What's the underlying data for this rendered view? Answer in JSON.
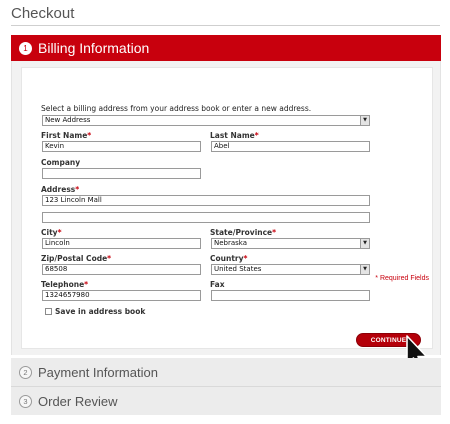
{
  "page": {
    "title": "Checkout"
  },
  "billing": {
    "step_number": "1",
    "title": "Billing Information",
    "intro": "Select a billing address from your address book or enter a new address.",
    "address_select": {
      "value": "New Address"
    },
    "first_name": {
      "label": "First Name",
      "value": "Kevin"
    },
    "last_name": {
      "label": "Last Name",
      "value": "Abel"
    },
    "company": {
      "label": "Company",
      "value": ""
    },
    "address": {
      "label": "Address",
      "line1": "123 Lincoln Mall",
      "line2": ""
    },
    "city": {
      "label": "City",
      "value": "Lincoln"
    },
    "state": {
      "label": "State/Province",
      "value": "Nebraska"
    },
    "zip": {
      "label": "Zip/Postal Code",
      "value": "68508"
    },
    "country": {
      "label": "Country",
      "value": "United States"
    },
    "telephone": {
      "label": "Telephone",
      "value": "1324657980"
    },
    "fax": {
      "label": "Fax",
      "value": ""
    },
    "save_label": "Save in address book",
    "required_note": "* Required Fields",
    "continue_label": "CONTINUE",
    "required_marker": "*"
  },
  "steps": [
    {
      "number": "2",
      "title": "Payment Information"
    },
    {
      "number": "3",
      "title": "Order Review"
    }
  ],
  "colors": {
    "accent": "#c8000d",
    "panel": "#ececec"
  }
}
